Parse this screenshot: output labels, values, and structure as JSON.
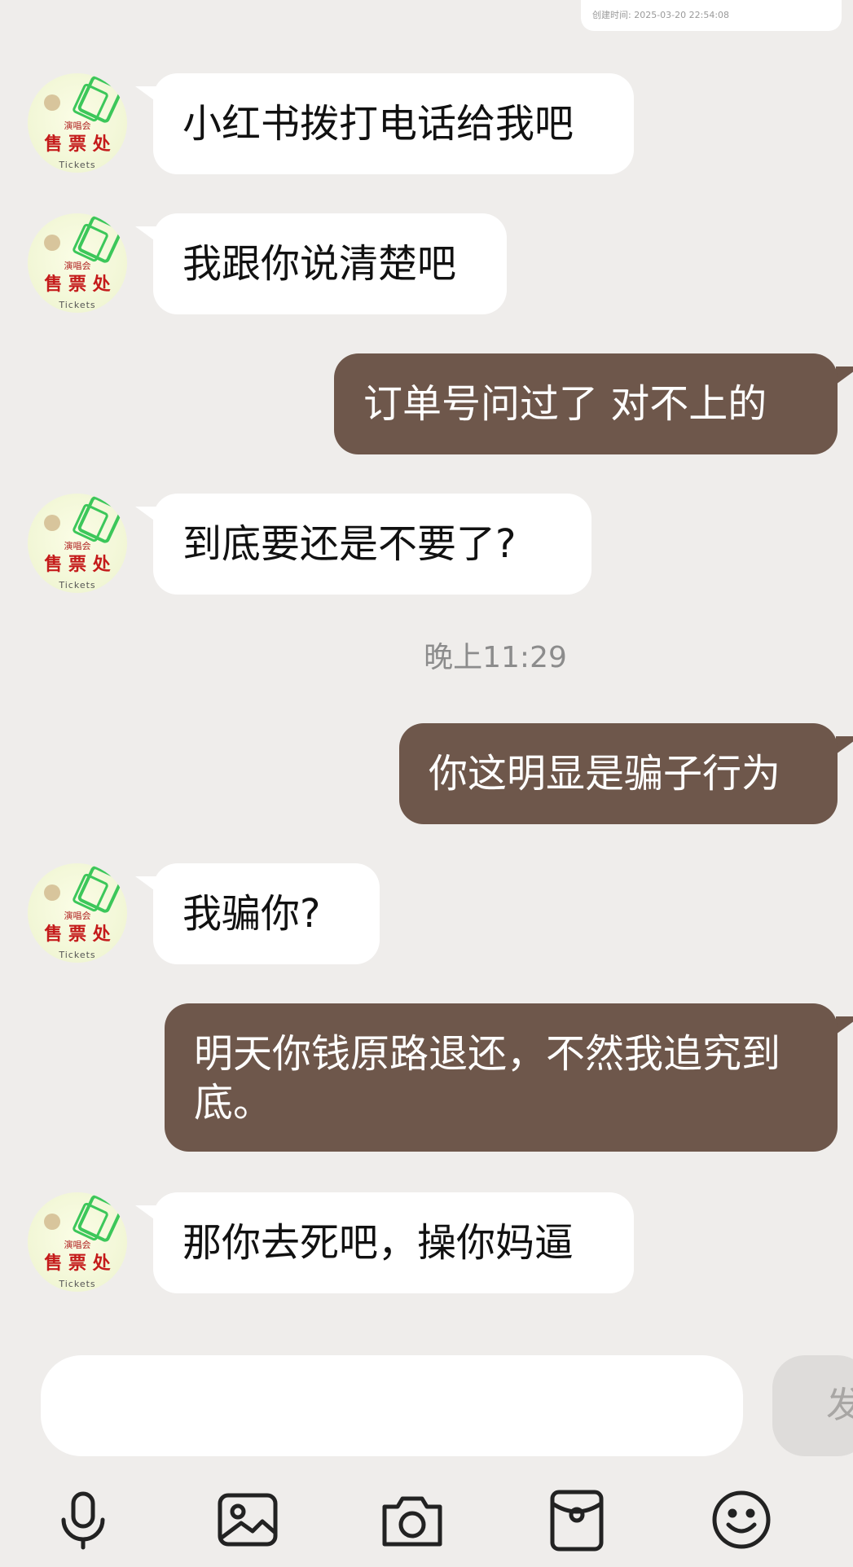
{
  "top_card": {
    "text": "创建时间: 2025-03-20 22:54:08"
  },
  "avatar": {
    "label_top": "演唱会",
    "label_main": "售 票 处",
    "label_sub": "Tickets"
  },
  "messages": [
    {
      "side": "in",
      "text": "小红书拨打电话给我吧"
    },
    {
      "side": "in",
      "text": "我跟你说清楚吧"
    },
    {
      "side": "out",
      "text": "订单号问过了  对不上的"
    },
    {
      "side": "in",
      "text": "到底要还是不要了?"
    },
    {
      "side": "out",
      "text": "你这明显是骗子行为"
    },
    {
      "side": "in",
      "text": "我骗你?"
    },
    {
      "side": "out",
      "text": "明天你钱原路退还，不然我追究到底。"
    },
    {
      "side": "in",
      "text": "那你去死吧，操你妈逼"
    }
  ],
  "timestamp": "晚上11:29",
  "composer": {
    "input_value": "",
    "send_label": "发"
  },
  "toolbar": {
    "icons": [
      "microphone-icon",
      "image-icon",
      "camera-icon",
      "red-packet-icon",
      "emoji-icon"
    ]
  },
  "colors": {
    "background": "#efedeb",
    "incoming_bubble": "#ffffff",
    "outgoing_bubble": "#6e574b"
  }
}
